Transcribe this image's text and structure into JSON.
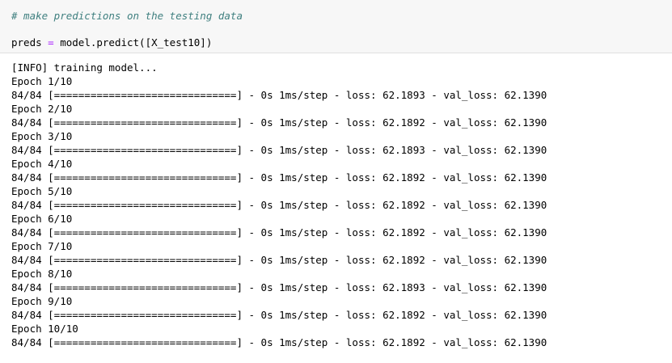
{
  "code_cell": {
    "comment": "# make predictions on the testing data",
    "code_var": "preds",
    "code_op": " = ",
    "code_call": "model.predict([X_test10])"
  },
  "output": {
    "lines": [
      "[INFO] training model...",
      "Epoch 1/10",
      "84/84 [==============================] - 0s 1ms/step - loss: 62.1893 - val_loss: 62.1390",
      "Epoch 2/10",
      "84/84 [==============================] - 0s 1ms/step - loss: 62.1892 - val_loss: 62.1390",
      "Epoch 3/10",
      "84/84 [==============================] - 0s 1ms/step - loss: 62.1893 - val_loss: 62.1390",
      "Epoch 4/10",
      "84/84 [==============================] - 0s 1ms/step - loss: 62.1892 - val_loss: 62.1390",
      "Epoch 5/10",
      "84/84 [==============================] - 0s 1ms/step - loss: 62.1892 - val_loss: 62.1390",
      "Epoch 6/10",
      "84/84 [==============================] - 0s 1ms/step - loss: 62.1892 - val_loss: 62.1390",
      "Epoch 7/10",
      "84/84 [==============================] - 0s 1ms/step - loss: 62.1892 - val_loss: 62.1390",
      "Epoch 8/10",
      "84/84 [==============================] - 0s 1ms/step - loss: 62.1893 - val_loss: 62.1390",
      "Epoch 9/10",
      "84/84 [==============================] - 0s 1ms/step - loss: 62.1892 - val_loss: 62.1390",
      "Epoch 10/10",
      "84/84 [==============================] - 0s 1ms/step - loss: 62.1892 - val_loss: 62.1390"
    ]
  }
}
